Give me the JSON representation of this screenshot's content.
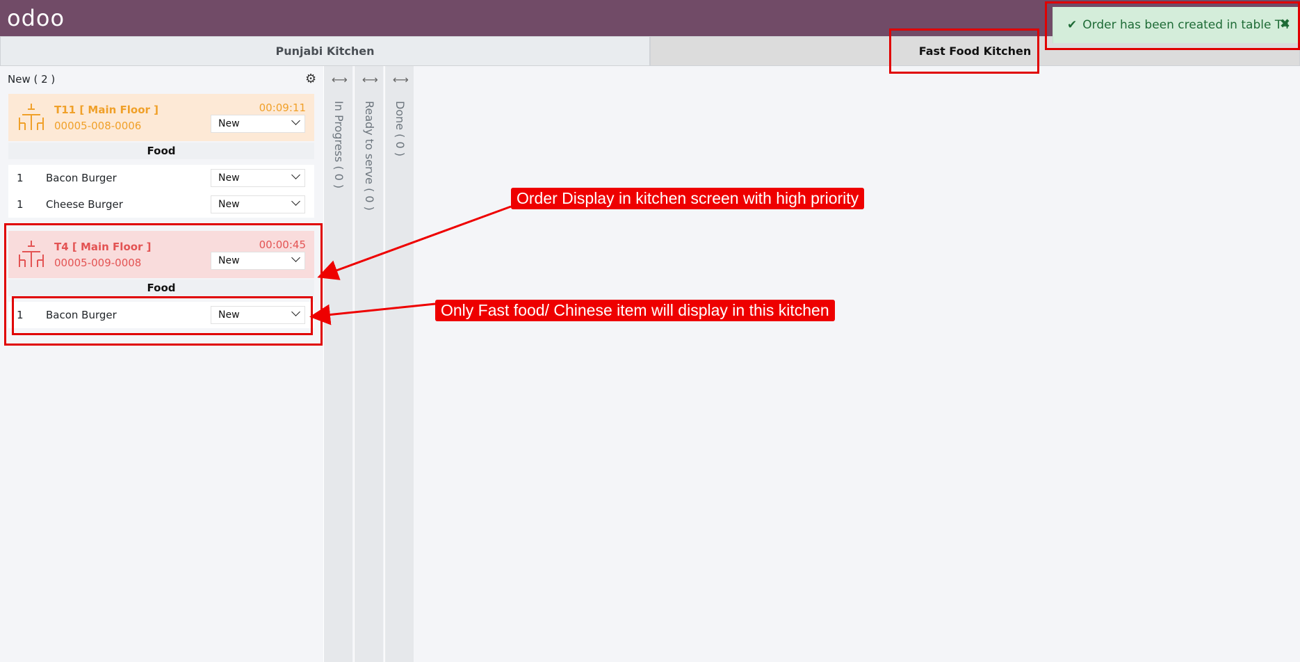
{
  "app": {
    "logo": "odoo"
  },
  "tabs": [
    {
      "label": "Punjabi Kitchen"
    },
    {
      "label": "Fast Food Kitchen"
    }
  ],
  "toast": {
    "message": "Order has been created in table T4",
    "close": "✖",
    "check": "✔"
  },
  "column": {
    "title": "New ( 2 )"
  },
  "orders": [
    {
      "table": "T11 [ Main Floor ]",
      "ref": "00005-008-0006",
      "time": "00:09:11",
      "status": "New",
      "category": "Food",
      "lines": [
        {
          "qty": "1",
          "name": "Bacon Burger",
          "status": "New"
        },
        {
          "qty": "1",
          "name": "Cheese Burger",
          "status": "New"
        }
      ]
    },
    {
      "table": "T4 [ Main Floor ]",
      "ref": "00005-009-0008",
      "time": "00:00:45",
      "status": "New",
      "category": "Food",
      "lines": [
        {
          "qty": "1",
          "name": "Bacon Burger",
          "status": "New"
        }
      ]
    }
  ],
  "stages": [
    {
      "label": "In Progress ( 0 )"
    },
    {
      "label": "Ready to serve ( 0 )"
    },
    {
      "label": "Done ( 0 )"
    }
  ],
  "annotations": {
    "priority": "Order Display in kitchen screen with high priority",
    "fastfood": "Only Fast food/ Chinese item will display in this kitchen"
  },
  "colors": {
    "topbar": "#714b67",
    "warm": "#f0a029",
    "hot": "#e35353",
    "annotation": "#ee0000"
  }
}
